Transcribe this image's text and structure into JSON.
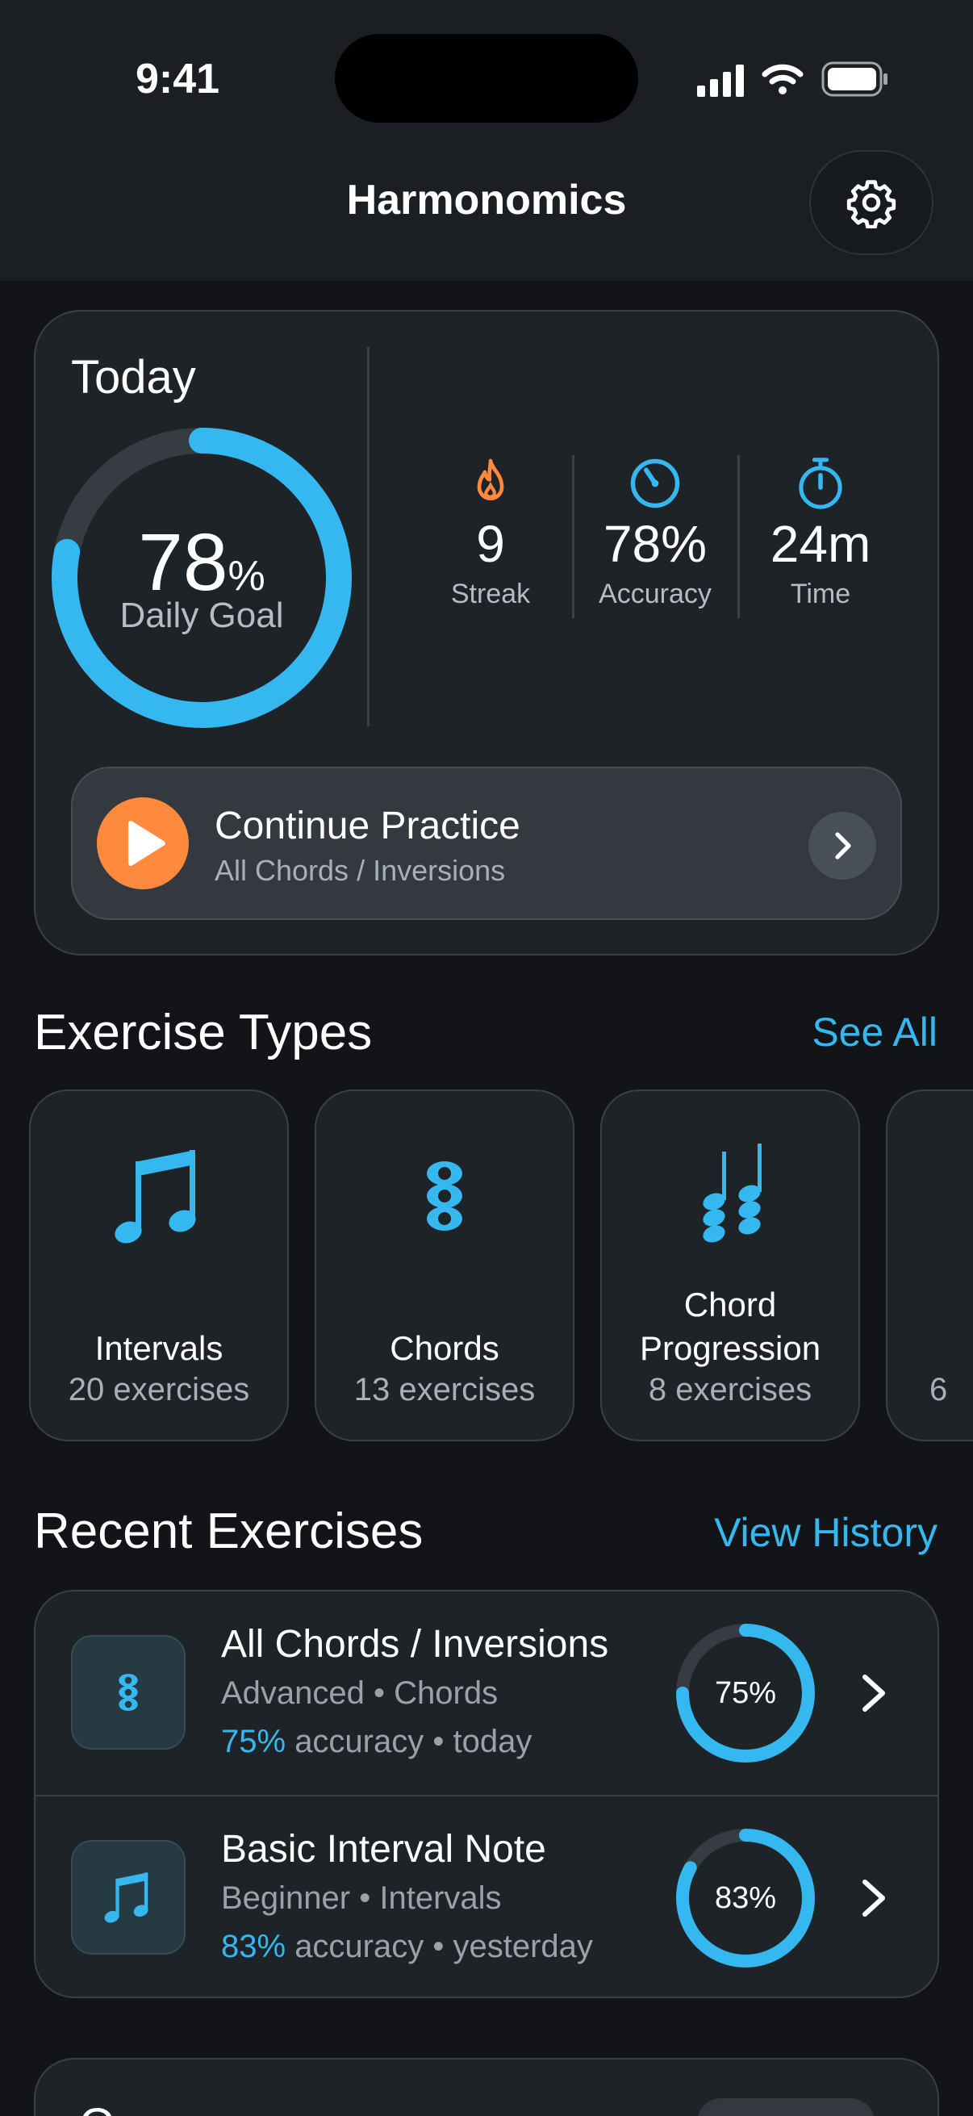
{
  "status_bar": {
    "time": "9:41"
  },
  "header": {
    "title": "Harmonomics",
    "settings_icon": "gear-icon"
  },
  "today": {
    "label": "Today",
    "goal_percent": 78,
    "goal_value": "78",
    "goal_unit": "%",
    "goal_label": "Daily Goal",
    "stats": [
      {
        "icon": "flame-icon",
        "value": "9",
        "label": "Streak",
        "color": "#ff8a3d"
      },
      {
        "icon": "gauge-icon",
        "value": "78%",
        "label": "Accuracy",
        "color": "#35b8f0"
      },
      {
        "icon": "stopwatch-icon",
        "value": "24m",
        "label": "Time",
        "color": "#35b8f0"
      }
    ],
    "continue": {
      "title": "Continue Practice",
      "subtitle": "All Chords / Inversions"
    }
  },
  "exercise_types": {
    "title": "Exercise Types",
    "link": "See All",
    "tiles": [
      {
        "icon": "eighth-notes-icon",
        "name": "Intervals",
        "count": "20 exercises"
      },
      {
        "icon": "stacked-notes-icon",
        "name": "Chords",
        "count": "13 exercises"
      },
      {
        "icon": "chord-sequence-icon",
        "name_line1": "Chord",
        "name_line2": "Progression",
        "count": "8 exercises"
      },
      {
        "count_partial": "6"
      }
    ]
  },
  "recent": {
    "title": "Recent Exercises",
    "link": "View History",
    "items": [
      {
        "icon": "stacked-notes-icon",
        "title": "All Chords / Inversions",
        "level": "Advanced",
        "category": "Chords",
        "accuracy": "75%",
        "accuracy_suffix": "accuracy",
        "when": "today",
        "ring_label": "75%",
        "ring_value": 0.75
      },
      {
        "icon": "eighth-notes-icon",
        "title": "Basic Interval Note",
        "level": "Beginner",
        "category": "Intervals",
        "accuracy": "83%",
        "accuracy_suffix": "accuracy",
        "when": "yesterday",
        "ring_label": "83%",
        "ring_value": 0.83
      }
    ]
  },
  "bottom_section": {
    "title": "Q"
  },
  "colors": {
    "accent": "#35b8f0",
    "orange": "#ff8a3d",
    "background": "#121417",
    "card": "#1e2327"
  }
}
